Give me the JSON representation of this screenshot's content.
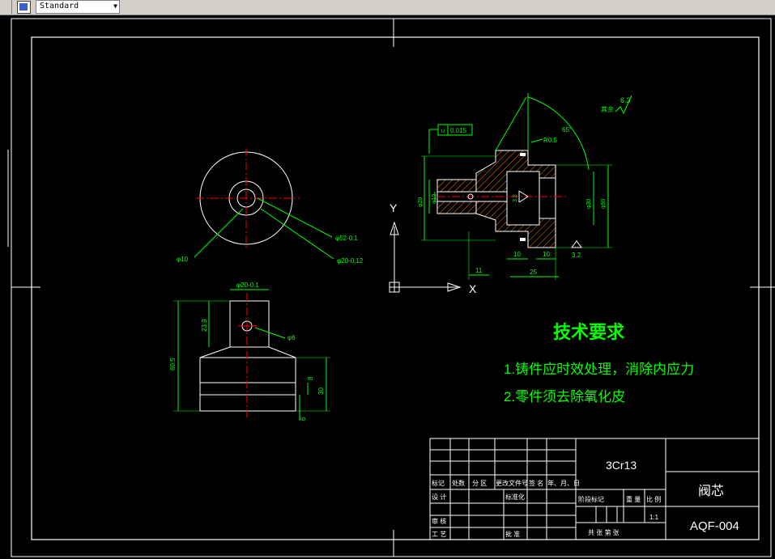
{
  "toolbar": {
    "text_style": "Standard",
    "text_style_icon": "text-style-icon",
    "dropdown_icon": "chevron-down-icon"
  },
  "colors": {
    "background": "#000000",
    "outline": "#ffffff",
    "center_line": "#ff0000",
    "dimension": "#00ff00",
    "hatch": "#ff7f00",
    "text_highlight": "#00ff00"
  },
  "drawing": {
    "top_view_dims": {
      "inner_dia": "φ10",
      "outer_dia_a": "φ52-0.1",
      "outer_dia_b": "φ20-0.12"
    },
    "front_view_dims": {
      "top_width": "φ20-0.1",
      "height_a": "23.9",
      "height_total": "60.5",
      "hole": "φ6",
      "side_a": "8",
      "side_b": "30",
      "side_c": "6"
    },
    "section_view": {
      "tolerance": "0.015",
      "angle": "65°",
      "radius": "R0.5",
      "surface_finish_a": "6.3",
      "surface_finish_label": "其余",
      "surface_finish_b": "3.2",
      "dim_left_a": "φ6",
      "dim_left_b": "φ10",
      "dim_left_c": "φ20",
      "dim_right_a": "φ30",
      "dim_right_b": "φ50",
      "bottom_11": "11",
      "bottom_10a": "10",
      "bottom_10b": "10",
      "bottom_25": "25",
      "inner_label": "3.2"
    },
    "axes": {
      "x_label": "X",
      "y_label": "Y"
    },
    "tech_title": "技术要求",
    "tech_items": [
      "1.铸件应时效处理，消除内应力",
      "2.零件须去除氧化皮"
    ]
  },
  "title_block": {
    "material": "3Cr13",
    "part_name": "阀芯",
    "drawing_no": "AQF-004",
    "scale": "1:1",
    "row_labels": [
      "标记",
      "处数",
      "分 区",
      "更改文件号",
      "签 名",
      "年、月、日"
    ],
    "design": "设 计",
    "standardize": "标准化",
    "review": "审 核",
    "process": "工 艺",
    "approve": "批 准",
    "stage_mark": "阶段标记",
    "weight": "重 量",
    "ratio": "比 例",
    "sheets": "共   张  第   张"
  }
}
